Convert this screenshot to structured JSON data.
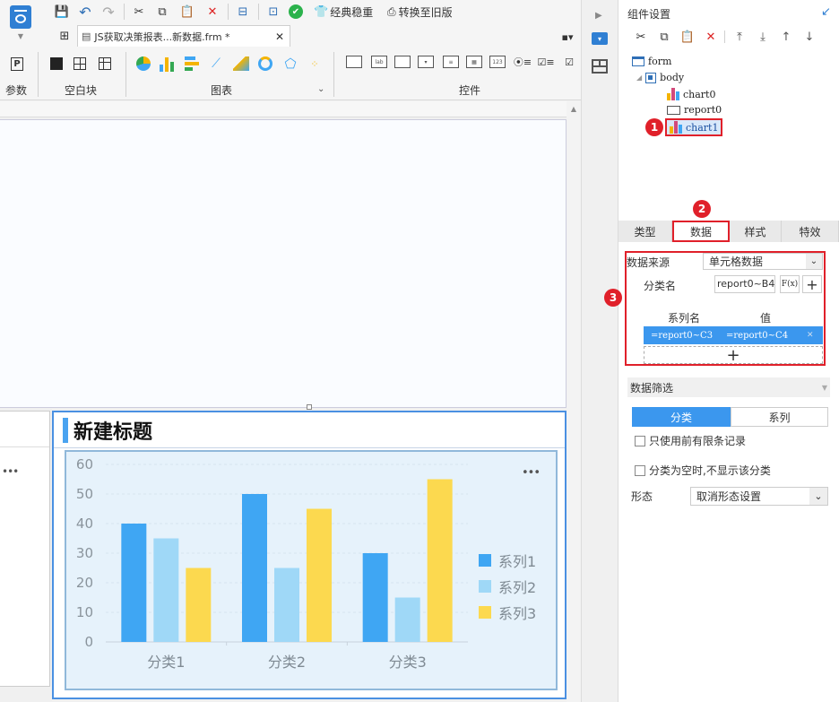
{
  "toolbar": {
    "tab_title": "JS获取决策报表...新数据.frm *",
    "classic_label": "经典稳重",
    "convert_label": "转换至旧版",
    "groups": {
      "params": "参数",
      "blank": "空白块",
      "chart": "图表",
      "widget": "控件"
    }
  },
  "canvas": {
    "chart_title": "新建标题",
    "more": "•••"
  },
  "chart_data": {
    "type": "bar",
    "categories": [
      "分类1",
      "分类2",
      "分类3"
    ],
    "series": [
      {
        "name": "系列1",
        "values": [
          40,
          50,
          30
        ],
        "color": "#3fa6f3"
      },
      {
        "name": "系列2",
        "values": [
          35,
          25,
          15
        ],
        "color": "#9fd8f7"
      },
      {
        "name": "系列3",
        "values": [
          25,
          45,
          55
        ],
        "color": "#fcd94f"
      }
    ],
    "yticks": [
      "0",
      "10",
      "20",
      "30",
      "40",
      "50",
      "60"
    ],
    "ylim": [
      0,
      60
    ],
    "legend": "right"
  },
  "panel": {
    "title": "组件设置",
    "tree": {
      "form": "form",
      "body": "body",
      "chart0": "chart0",
      "report0": "report0",
      "chart1": "chart1"
    },
    "tabs": [
      "类型",
      "数据",
      "样式",
      "特效"
    ],
    "data_source_label": "数据来源",
    "data_source_value": "单元格数据",
    "category_label": "分类名",
    "category_value": "report0~B4",
    "fx_label": "F(x)",
    "series_name_header": "系列名",
    "value_header": "值",
    "series_name_value": "=report0~C3",
    "value_value": "=report0~C4",
    "filter_title": "数据筛选",
    "filter_tabs": [
      "分类",
      "系列"
    ],
    "only_top_label": "只使用前有限条记录",
    "hide_empty_label": "分类为空时,不显示该分类",
    "shape_label": "形态",
    "shape_value": "取消形态设置"
  },
  "annotations": [
    "1",
    "2",
    "3"
  ]
}
